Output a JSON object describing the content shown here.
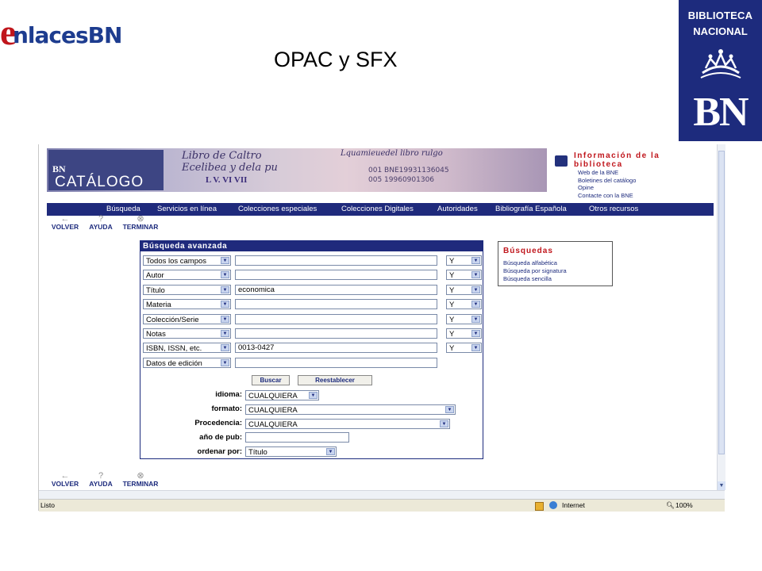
{
  "slide": {
    "logo_text": "nlacesBN",
    "logo_initial": "e",
    "title": "OPAC y SFX",
    "bn_box": {
      "line1": "BIBLIOTECA",
      "line2": "NACIONAL",
      "mark": "BN"
    }
  },
  "header": {
    "banner_mark": "BN",
    "banner_title": "CATÁLOGO",
    "banner_script_1": "Libro de Caltro",
    "banner_script_2": "Ecelibea y dela pu",
    "banner_script_3": "Lquamieuedel libro rulgo",
    "banner_marks": "L  V.  VI  VII",
    "banner_codes": [
      "001   BNE19931136045",
      "005   19960901306"
    ],
    "info_title": "Información de la biblioteca",
    "info_links": [
      "Web de la BNE",
      "Boletines del catálogo",
      "Opine",
      "Contacte con la BNE"
    ]
  },
  "nav": {
    "items": [
      "Búsqueda",
      "Servicios en línea",
      "Colecciones especiales",
      "Colecciones Digitales",
      "Autoridades",
      "Bibliografía Española",
      "Otros recursos"
    ]
  },
  "toolbar": {
    "volver": "VOLVER",
    "ayuda": "AYUDA",
    "terminar": "TERMINAR"
  },
  "form": {
    "header": "Búsqueda avanzada",
    "rows": [
      {
        "field": "Todos los campos",
        "value": "",
        "op": "Y"
      },
      {
        "field": "Autor",
        "value": "",
        "op": "Y"
      },
      {
        "field": "Título",
        "value": "economica",
        "op": "Y"
      },
      {
        "field": "Materia",
        "value": "",
        "op": "Y"
      },
      {
        "field": "Colección/Serie",
        "value": "",
        "op": "Y"
      },
      {
        "field": "Notas",
        "value": "",
        "op": "Y"
      },
      {
        "field": "ISBN, ISSN, etc.",
        "value": "0013-0427",
        "op": "Y"
      },
      {
        "field": "Datos de edición",
        "value": ""
      }
    ],
    "buscar": "Buscar",
    "reestablecer": "Reestablecer",
    "idioma_label": "idioma:",
    "idioma_value": "CUALQUIERA",
    "formato_label": "formato:",
    "formato_value": "CUALQUIERA",
    "procedencia_label": "Procedencia:",
    "procedencia_value": "CUALQUIERA",
    "anio_label": "año de pub:",
    "anio_value": "",
    "ordenar_label": "ordenar por:",
    "ordenar_value": "Título"
  },
  "side_panel": {
    "title": "Búsquedas",
    "links": [
      "Búsqueda alfabética",
      "Búsqueda por signatura",
      "Búsqueda sencilla"
    ]
  },
  "status": {
    "left": "Listo",
    "zone": "Internet",
    "zoom": "100%"
  }
}
